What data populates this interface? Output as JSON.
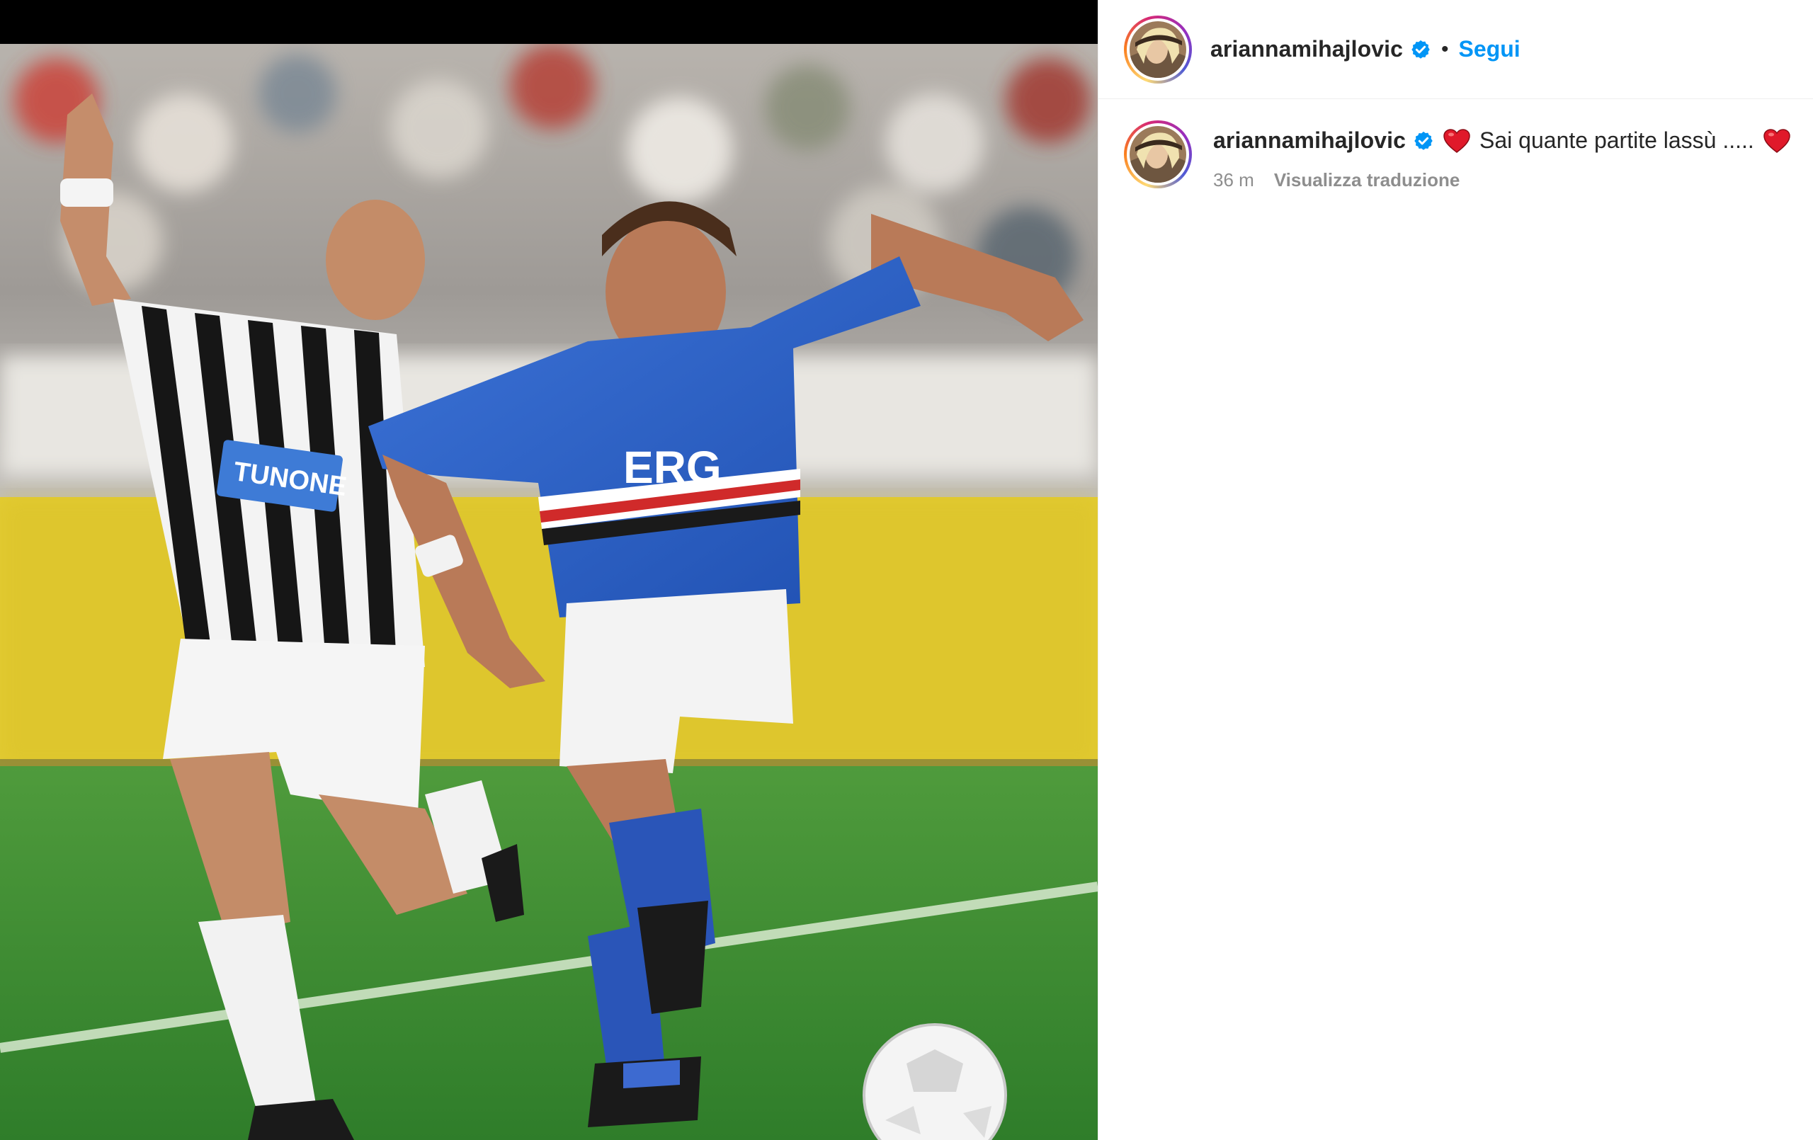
{
  "post": {
    "media": {
      "alt": "",
      "jersey_left_text": "TUNONE",
      "jersey_right_text": "ERG"
    }
  },
  "header": {
    "username": "ariannamihajlovic",
    "verified_icon": "verified-badge-icon",
    "separator": "•",
    "follow_label": "Segui"
  },
  "comments": [
    {
      "username": "ariannamihajlovic",
      "verified_icon": "verified-badge-icon",
      "leading_emoji": "heart-icon",
      "text": "Sai quante partite lassù .....",
      "trailing_emoji": "heart-icon",
      "time": "36 m",
      "translate_label": "Visualizza traduzione"
    }
  ],
  "colors": {
    "follow": "#0095f6",
    "verified": "#0095f6",
    "heart": "#e0192a",
    "muted_text": "#8e8e8e",
    "primary_text": "#262626"
  }
}
